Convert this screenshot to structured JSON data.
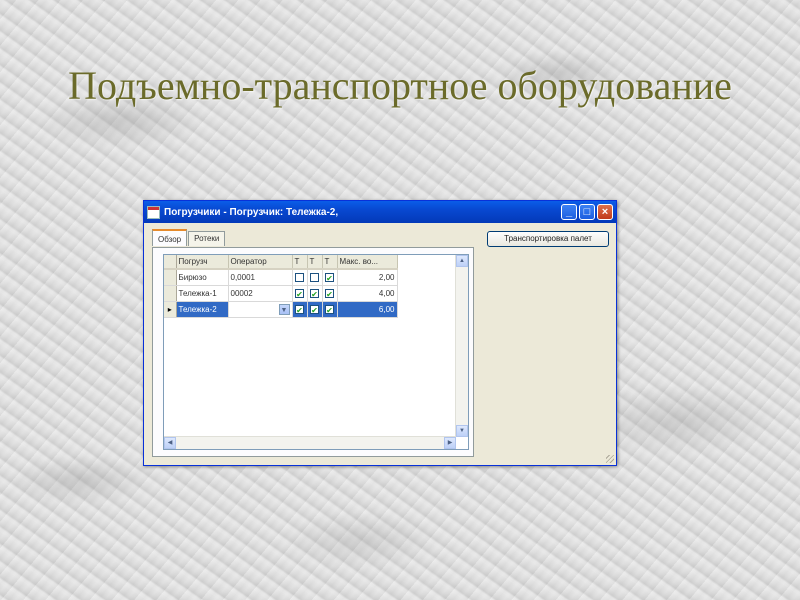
{
  "slide": {
    "title": "Подъемно-транспортное оборудование"
  },
  "window": {
    "title": "Погрузчики - Погрузчик: Тележка-2,",
    "minimize": "_",
    "maximize": "□",
    "close": "×"
  },
  "tabs": [
    {
      "label": "Обзор",
      "active": true
    },
    {
      "label": "Ротеки",
      "active": false
    }
  ],
  "side_button": {
    "label": "Транспортировка палет"
  },
  "grid": {
    "columns": [
      "Погрузч",
      "Оператор",
      "Т",
      "Т",
      "Т",
      "Макс. во..."
    ],
    "rows": [
      {
        "indicator": "",
        "name": "Бирюзо",
        "operator": "0,0001",
        "c1": false,
        "c2": false,
        "c3": true,
        "max": "2,00",
        "selected": false
      },
      {
        "indicator": "",
        "name": "Тележка-1",
        "operator": "00002",
        "c1": true,
        "c2": true,
        "c3": true,
        "max": "4,00",
        "selected": false
      },
      {
        "indicator": "▸",
        "name": "Тележка-2",
        "operator": "",
        "c1": true,
        "c2": true,
        "c3": true,
        "max": "6,00",
        "selected": true
      }
    ]
  },
  "colors": {
    "title_color": "#6b6b2a",
    "titlebar": "#0a5de8",
    "selection": "#316ac5",
    "checkmark": "#21a121"
  }
}
